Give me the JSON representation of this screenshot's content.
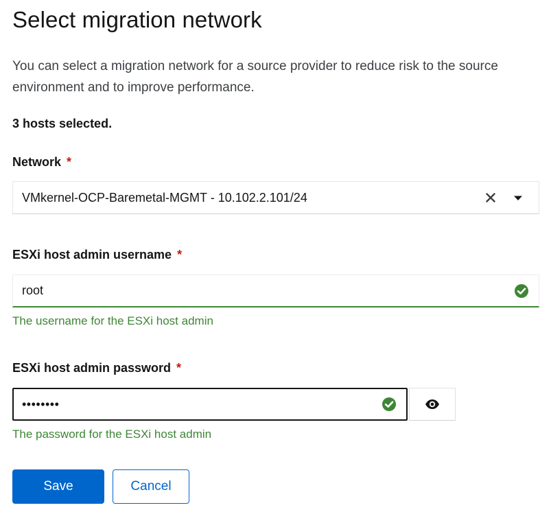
{
  "dialog": {
    "title": "Select migration network",
    "description": "You can select a migration network for a source provider to reduce risk to the source environment and to improve performance.",
    "hosts_selected": "3 hosts selected."
  },
  "network": {
    "label": "Network",
    "required_marker": "*",
    "selected_value": "VMkernel-OCP-Baremetal-MGMT - 10.102.2.101/24",
    "clear_icon": "close-icon",
    "toggle_icon": "caret-down-icon"
  },
  "username": {
    "label": "ESXi host admin username",
    "required_marker": "*",
    "value": "root",
    "helper": "The username for the ESXi host admin",
    "status_icon": "check-circle-icon"
  },
  "password": {
    "label": "ESXi host admin password",
    "required_marker": "*",
    "masked_value": "••••••••",
    "helper": "The password for the ESXi host admin",
    "status_icon": "check-circle-icon",
    "reveal_icon": "eye-icon"
  },
  "actions": {
    "save_label": "Save",
    "cancel_label": "Cancel"
  },
  "colors": {
    "primary": "#0066cc",
    "success": "#3e8635",
    "required": "#c9190b",
    "text": "#151515"
  }
}
